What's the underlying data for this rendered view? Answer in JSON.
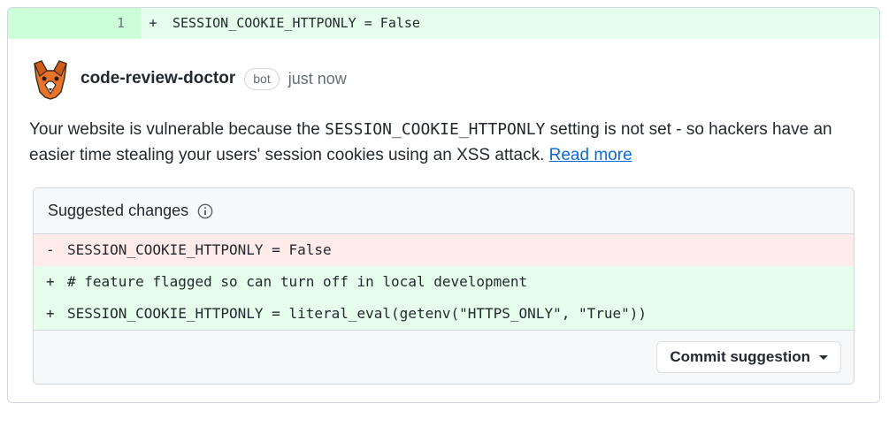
{
  "diff_added": {
    "line_number": "1",
    "marker": "+",
    "code": "SESSION_COOKIE_HTTPONLY = False"
  },
  "comment": {
    "author": "code-review-doctor",
    "badge": "bot",
    "timestamp": "just now",
    "body_prefix": "Your website is vulnerable because the ",
    "body_code": "SESSION_COOKIE_HTTPONLY",
    "body_suffix": " setting is not set - so hackers have an easier time stealing your users' session cookies using an XSS attack. ",
    "link_text": "Read more"
  },
  "suggestion": {
    "header": "Suggested changes",
    "rows": [
      {
        "type": "del",
        "marker": "-",
        "code": "SESSION_COOKIE_HTTPONLY = False"
      },
      {
        "type": "add",
        "marker": "+",
        "code": "# feature flagged so can turn off in local development"
      },
      {
        "type": "add",
        "marker": "+",
        "code": "SESSION_COOKIE_HTTPONLY = literal_eval(getenv(\"HTTPS_ONLY\", \"True\"))"
      }
    ],
    "commit_button": "Commit suggestion"
  }
}
